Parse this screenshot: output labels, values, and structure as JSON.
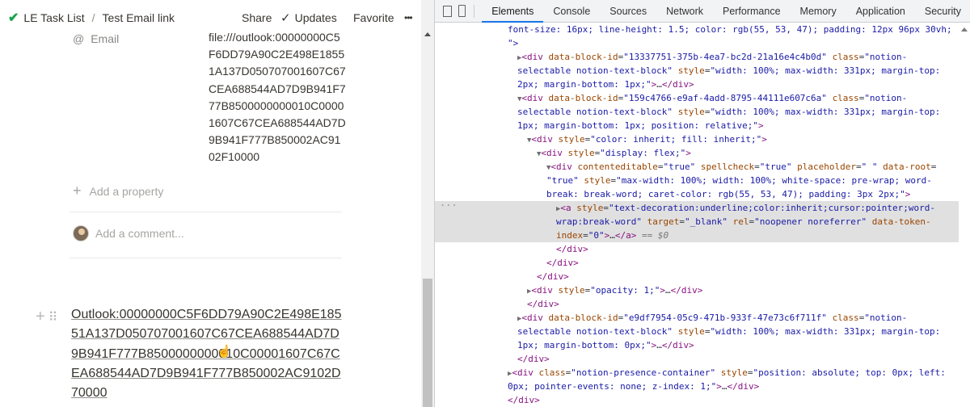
{
  "topbar": {
    "check_icon": "check-icon",
    "breadcrumb_1": "LE Task List",
    "breadcrumb_sep": "/",
    "breadcrumb_2": "Test Email link",
    "share_label": "Share",
    "updates_label": "Updates",
    "favorite_label": "Favorite",
    "more_label": "•••"
  },
  "property": {
    "label": "Email",
    "value": "file:///outlook:00000000C5F6DD79A90C2E498E18551A137D050707001607C67CEA688544AD7D9B941F777B8500000000010C00001607C67CEA688544AD7D9B941F777B850002AC9102F10000"
  },
  "add_property_label": "Add a property",
  "add_comment_placeholder": "Add a comment...",
  "link_block": {
    "text": "Outlook:00000000C5F6DD79A90C2E498E18551A137D050707001607C67CEA688544AD7D9B941F777B8500000000010C00001607C67CEA688544AD7D9B941F777B850002AC9102D70000"
  },
  "devtools": {
    "tabs": [
      "Elements",
      "Console",
      "Sources",
      "Network",
      "Performance",
      "Memory",
      "Application",
      "Security"
    ],
    "active_tab": "Elements",
    "dots": "..."
  }
}
